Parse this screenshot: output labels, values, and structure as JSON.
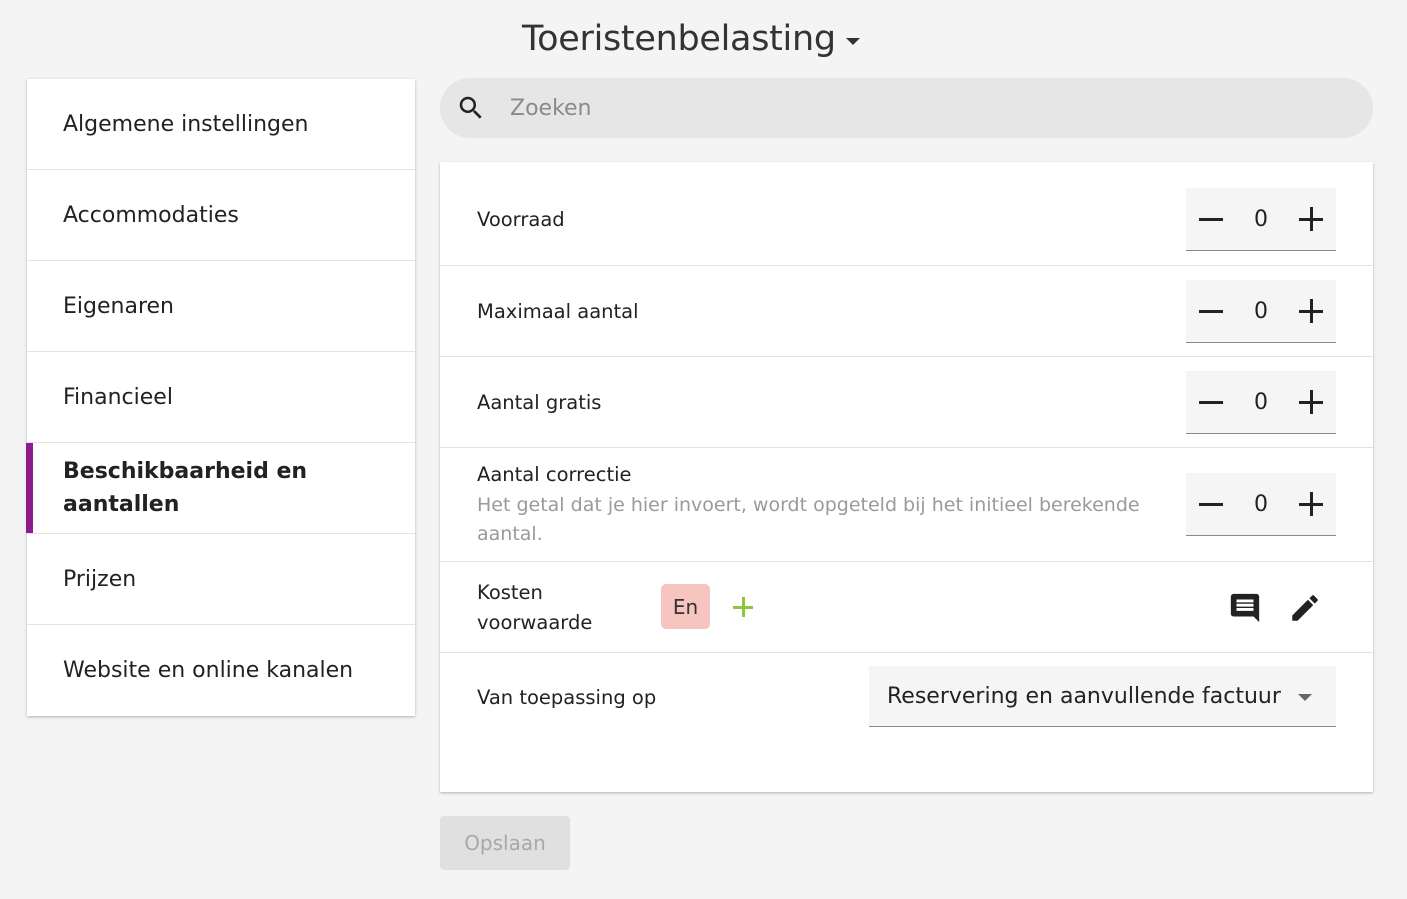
{
  "header": {
    "title": "Toeristenbelasting"
  },
  "sidebar": {
    "items": [
      {
        "label": "Algemene instellingen"
      },
      {
        "label": "Accommodaties"
      },
      {
        "label": "Eigenaren"
      },
      {
        "label": "Financieel"
      },
      {
        "label": "Beschikbaarheid en aantallen",
        "active": true
      },
      {
        "label": "Prijzen"
      },
      {
        "label": "Website en online kanalen"
      }
    ],
    "accent_color": "#8e1c8e"
  },
  "search": {
    "placeholder": "Zoeken",
    "value": ""
  },
  "form": {
    "voorraad": {
      "label": "Voorraad",
      "value": "0"
    },
    "maximaal": {
      "label": "Maximaal aantal",
      "value": "0"
    },
    "gratis": {
      "label": "Aantal gratis",
      "value": "0"
    },
    "correctie": {
      "label": "Aantal correctie",
      "help": "Het getal dat je hier invoert, wordt opgeteld bij het initieel berekende aantal.",
      "value": "0"
    },
    "kosten": {
      "label_line1": "Kosten",
      "label_line2": "voorwaarde",
      "language_badge": "En",
      "badge_color": "#f7c5c0",
      "add_color": "#8cc63f"
    },
    "toepassing": {
      "label": "Van toepassing op",
      "selected": "Reservering en aanvullende factuur"
    }
  },
  "actions": {
    "save_label": "Opslaan"
  },
  "icons": {
    "search": "search-icon",
    "comment": "comment-icon",
    "edit": "pencil-icon",
    "add": "plus-icon",
    "dropdown": "caret-down-icon"
  }
}
